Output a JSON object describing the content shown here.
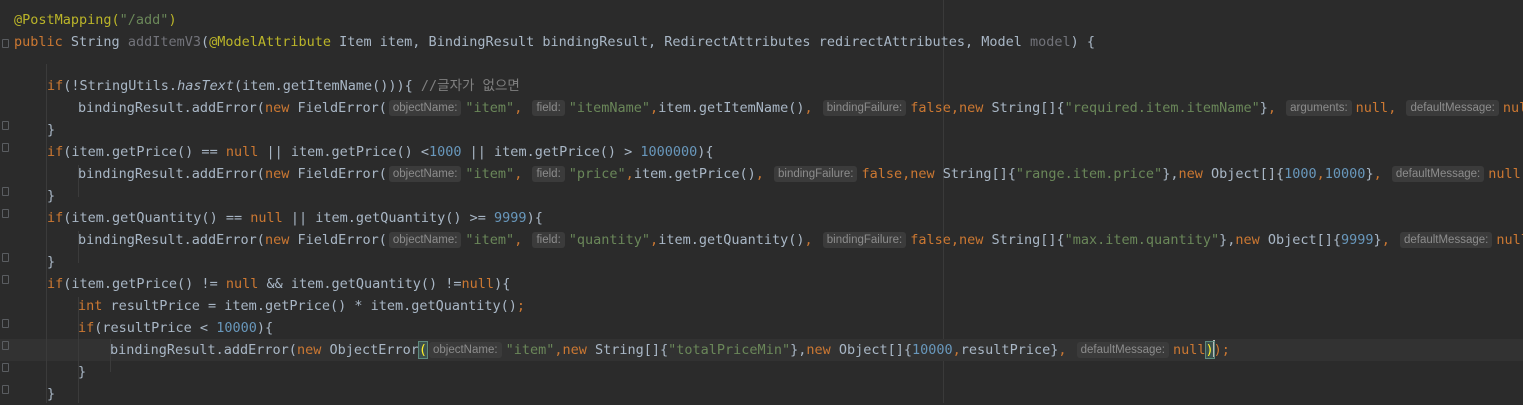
{
  "lines": [
    {
      "tokens": [
        {
          "t": "@PostMapping(",
          "c": "ann"
        },
        {
          "t": "\"/add\"",
          "c": "str"
        },
        {
          "t": ")",
          "c": "ann"
        }
      ]
    },
    {
      "tokens": [
        {
          "t": "public ",
          "c": "kw"
        },
        {
          "t": "String ",
          "c": ""
        },
        {
          "t": "addItemV3",
          "c": "unused"
        },
        {
          "t": "(",
          "c": ""
        },
        {
          "t": "@ModelAttribute ",
          "c": "ann"
        },
        {
          "t": "Item item, BindingResult bindingResult, RedirectAttributes redirectAttributes, Model ",
          "c": ""
        },
        {
          "t": "model",
          "c": "unused"
        },
        {
          "t": ") {",
          "c": ""
        }
      ]
    },
    {
      "tokens": []
    },
    {
      "tokens": [
        {
          "t": "if",
          "c": "kw"
        },
        {
          "t": "(!StringUtils.",
          "c": ""
        },
        {
          "t": "hasText",
          "c": "italic"
        },
        {
          "t": "(item.getItemName())){ ",
          "c": ""
        },
        {
          "t": "//글자가 없으면",
          "c": "cmt"
        }
      ]
    },
    {
      "tokens": [
        {
          "t": "bindingResult.addError(",
          "c": ""
        },
        {
          "t": "new ",
          "c": "kw"
        },
        {
          "t": "FieldError(",
          "c": ""
        },
        {
          "h": "objectName:"
        },
        {
          "t": "\"item\"",
          "c": "str"
        },
        {
          "t": ", ",
          "c": "kw"
        },
        {
          "h": "field:"
        },
        {
          "t": "\"itemName\"",
          "c": "str"
        },
        {
          "t": ",",
          "c": "kw"
        },
        {
          "t": "item.getItemName()",
          "c": ""
        },
        {
          "t": ", ",
          "c": "kw"
        },
        {
          "h": "bindingFailure:"
        },
        {
          "t": "false",
          "c": "kw"
        },
        {
          "t": ",",
          "c": "kw"
        },
        {
          "t": "new ",
          "c": "kw"
        },
        {
          "t": "String[]{",
          "c": ""
        },
        {
          "t": "\"required.item.itemName\"",
          "c": "str"
        },
        {
          "t": "}",
          "c": ""
        },
        {
          "t": ", ",
          "c": "kw"
        },
        {
          "h": "arguments:"
        },
        {
          "t": "null",
          "c": "kw"
        },
        {
          "t": ", ",
          "c": "kw"
        },
        {
          "h": "defaultMessage:"
        },
        {
          "t": "null",
          "c": "kw"
        },
        {
          "t": "));",
          "c": ""
        }
      ]
    },
    {
      "tokens": [
        {
          "t": "}",
          "c": ""
        }
      ]
    },
    {
      "tokens": [
        {
          "t": "if",
          "c": "kw"
        },
        {
          "t": "(item.getPrice() == ",
          "c": ""
        },
        {
          "t": "null ",
          "c": "kw"
        },
        {
          "t": "|| item.getPrice() <",
          "c": ""
        },
        {
          "t": "1000 ",
          "c": "num"
        },
        {
          "t": "|| item.getPrice() > ",
          "c": ""
        },
        {
          "t": "1000000",
          "c": "num"
        },
        {
          "t": "){",
          "c": ""
        }
      ]
    },
    {
      "tokens": [
        {
          "t": "bindingResult.addError(",
          "c": ""
        },
        {
          "t": "new ",
          "c": "kw"
        },
        {
          "t": "FieldError(",
          "c": ""
        },
        {
          "h": "objectName:"
        },
        {
          "t": "\"item\"",
          "c": "str"
        },
        {
          "t": ", ",
          "c": "kw"
        },
        {
          "h": "field:"
        },
        {
          "t": "\"price\"",
          "c": "str"
        },
        {
          "t": ",",
          "c": "kw"
        },
        {
          "t": "item.getPrice()",
          "c": ""
        },
        {
          "t": ", ",
          "c": "kw"
        },
        {
          "h": "bindingFailure:"
        },
        {
          "t": "false",
          "c": "kw"
        },
        {
          "t": ",",
          "c": "kw"
        },
        {
          "t": "new ",
          "c": "kw"
        },
        {
          "t": "String[]{",
          "c": ""
        },
        {
          "t": "\"range.item.price\"",
          "c": "str"
        },
        {
          "t": "},",
          "c": ""
        },
        {
          "t": "new ",
          "c": "kw"
        },
        {
          "t": "Object[]{",
          "c": ""
        },
        {
          "t": "1000",
          "c": "num"
        },
        {
          "t": ",",
          "c": "kw"
        },
        {
          "t": "10000",
          "c": "num"
        },
        {
          "t": "}",
          "c": ""
        },
        {
          "t": ", ",
          "c": "kw"
        },
        {
          "h": "defaultMessage:"
        },
        {
          "t": "null",
          "c": "kw"
        },
        {
          "t": "));",
          "c": ""
        }
      ]
    },
    {
      "tokens": [
        {
          "t": "}",
          "c": ""
        }
      ]
    },
    {
      "tokens": [
        {
          "t": "if",
          "c": "kw"
        },
        {
          "t": "(item.getQuantity() == ",
          "c": ""
        },
        {
          "t": "null ",
          "c": "kw"
        },
        {
          "t": "|| item.getQuantity() >= ",
          "c": ""
        },
        {
          "t": "9999",
          "c": "num"
        },
        {
          "t": "){",
          "c": ""
        }
      ]
    },
    {
      "tokens": [
        {
          "t": "bindingResult.addError(",
          "c": ""
        },
        {
          "t": "new ",
          "c": "kw"
        },
        {
          "t": "FieldError(",
          "c": ""
        },
        {
          "h": "objectName:"
        },
        {
          "t": "\"item\"",
          "c": "str"
        },
        {
          "t": ", ",
          "c": "kw"
        },
        {
          "h": "field:"
        },
        {
          "t": "\"quantity\"",
          "c": "str"
        },
        {
          "t": ",",
          "c": "kw"
        },
        {
          "t": "item.getQuantity()",
          "c": ""
        },
        {
          "t": ", ",
          "c": "kw"
        },
        {
          "h": "bindingFailure:"
        },
        {
          "t": "false",
          "c": "kw"
        },
        {
          "t": ",",
          "c": "kw"
        },
        {
          "t": "new ",
          "c": "kw"
        },
        {
          "t": "String[]{",
          "c": ""
        },
        {
          "t": "\"max.item.quantity\"",
          "c": "str"
        },
        {
          "t": "},",
          "c": ""
        },
        {
          "t": "new ",
          "c": "kw"
        },
        {
          "t": "Object[]{",
          "c": ""
        },
        {
          "t": "9999",
          "c": "num"
        },
        {
          "t": "}",
          "c": ""
        },
        {
          "t": ", ",
          "c": "kw"
        },
        {
          "h": "defaultMessage:"
        },
        {
          "t": "null",
          "c": "kw"
        },
        {
          "t": "));",
          "c": ""
        }
      ]
    },
    {
      "tokens": [
        {
          "t": "}",
          "c": ""
        }
      ]
    },
    {
      "tokens": [
        {
          "t": "if",
          "c": "kw"
        },
        {
          "t": "(item.getPrice() != ",
          "c": ""
        },
        {
          "t": "null ",
          "c": "kw"
        },
        {
          "t": "&& item.getQuantity() !=",
          "c": ""
        },
        {
          "t": "null",
          "c": "kw"
        },
        {
          "t": "){",
          "c": ""
        }
      ]
    },
    {
      "tokens": [
        {
          "t": "int ",
          "c": "kw"
        },
        {
          "t": "resultPrice = item.getPrice() * item.getQuantity()",
          "c": ""
        },
        {
          "t": ";",
          "c": "kw"
        }
      ]
    },
    {
      "tokens": [
        {
          "t": "if",
          "c": "kw"
        },
        {
          "t": "(resultPrice < ",
          "c": ""
        },
        {
          "t": "10000",
          "c": "num"
        },
        {
          "t": "){",
          "c": ""
        }
      ]
    },
    {
      "tokens": [
        {
          "t": "bindingResult.addError(",
          "c": ""
        },
        {
          "t": "new ",
          "c": "kw"
        },
        {
          "t": "ObjectError",
          "c": ""
        },
        {
          "t": "(",
          "c": "bm"
        },
        {
          "h": "objectName:"
        },
        {
          "t": "\"item\"",
          "c": "str"
        },
        {
          "t": ",",
          "c": "kw"
        },
        {
          "t": "new ",
          "c": "kw"
        },
        {
          "t": "String[]{",
          "c": ""
        },
        {
          "t": "\"totalPriceMin\"",
          "c": "str"
        },
        {
          "t": "},",
          "c": ""
        },
        {
          "t": "new ",
          "c": "kw"
        },
        {
          "t": "Object[]{",
          "c": ""
        },
        {
          "t": "10000",
          "c": "num"
        },
        {
          "t": ",",
          "c": "kw"
        },
        {
          "t": "resultPrice}",
          "c": ""
        },
        {
          "t": ", ",
          "c": "kw"
        },
        {
          "h": "defaultMessage:"
        },
        {
          "t": "null",
          "c": "kw"
        },
        {
          "t": ")",
          "c": "bm"
        },
        {
          "caret": true
        },
        {
          "t": ");",
          "c": "kw"
        }
      ]
    },
    {
      "tokens": [
        {
          "t": "}",
          "c": ""
        }
      ]
    },
    {
      "tokens": [
        {
          "t": "}",
          "c": ""
        }
      ]
    }
  ],
  "current_line_index": 15
}
